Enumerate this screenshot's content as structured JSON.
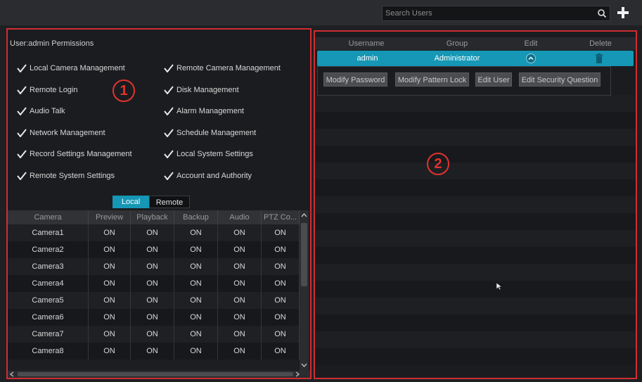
{
  "search": {
    "placeholder": "Search Users"
  },
  "permissions": {
    "title": "User:admin Permissions",
    "items": [
      "Local Camera Management",
      "Remote Camera Management",
      "Remote Login",
      "Disk Management",
      "Audio Talk",
      "Alarm Management",
      "Network Management",
      "Schedule Management",
      "Record Settings Management",
      "Local System Settings",
      "Remote System Settings",
      "Account and Authority"
    ]
  },
  "badges": {
    "left": "1",
    "right": "2"
  },
  "tabs": {
    "local": "Local",
    "remote": "Remote"
  },
  "camera_table": {
    "columns": [
      "Camera",
      "Preview",
      "Playback",
      "Backup",
      "Audio",
      "PTZ Co..."
    ],
    "rows": [
      [
        "Camera1",
        "ON",
        "ON",
        "ON",
        "ON",
        "ON"
      ],
      [
        "Camera2",
        "ON",
        "ON",
        "ON",
        "ON",
        "ON"
      ],
      [
        "Camera3",
        "ON",
        "ON",
        "ON",
        "ON",
        "ON"
      ],
      [
        "Camera4",
        "ON",
        "ON",
        "ON",
        "ON",
        "ON"
      ],
      [
        "Camera5",
        "ON",
        "ON",
        "ON",
        "ON",
        "ON"
      ],
      [
        "Camera6",
        "ON",
        "ON",
        "ON",
        "ON",
        "ON"
      ],
      [
        "Camera7",
        "ON",
        "ON",
        "ON",
        "ON",
        "ON"
      ],
      [
        "Camera8",
        "ON",
        "ON",
        "ON",
        "ON",
        "ON"
      ]
    ]
  },
  "users": {
    "columns": [
      "Username",
      "Group",
      "Edit",
      "Delete"
    ],
    "rows": [
      {
        "username": "admin",
        "group": "Administrator"
      }
    ],
    "actions": [
      "Modify Password",
      "Modify Pattern Lock",
      "Edit User",
      "Edit Security Question"
    ]
  },
  "colors": {
    "accent": "#1597b5",
    "annotation": "#d12d33"
  },
  "icons": [
    "search-icon",
    "add-icon",
    "check-icon",
    "expand-icon",
    "trash-icon",
    "cursor-icon"
  ]
}
